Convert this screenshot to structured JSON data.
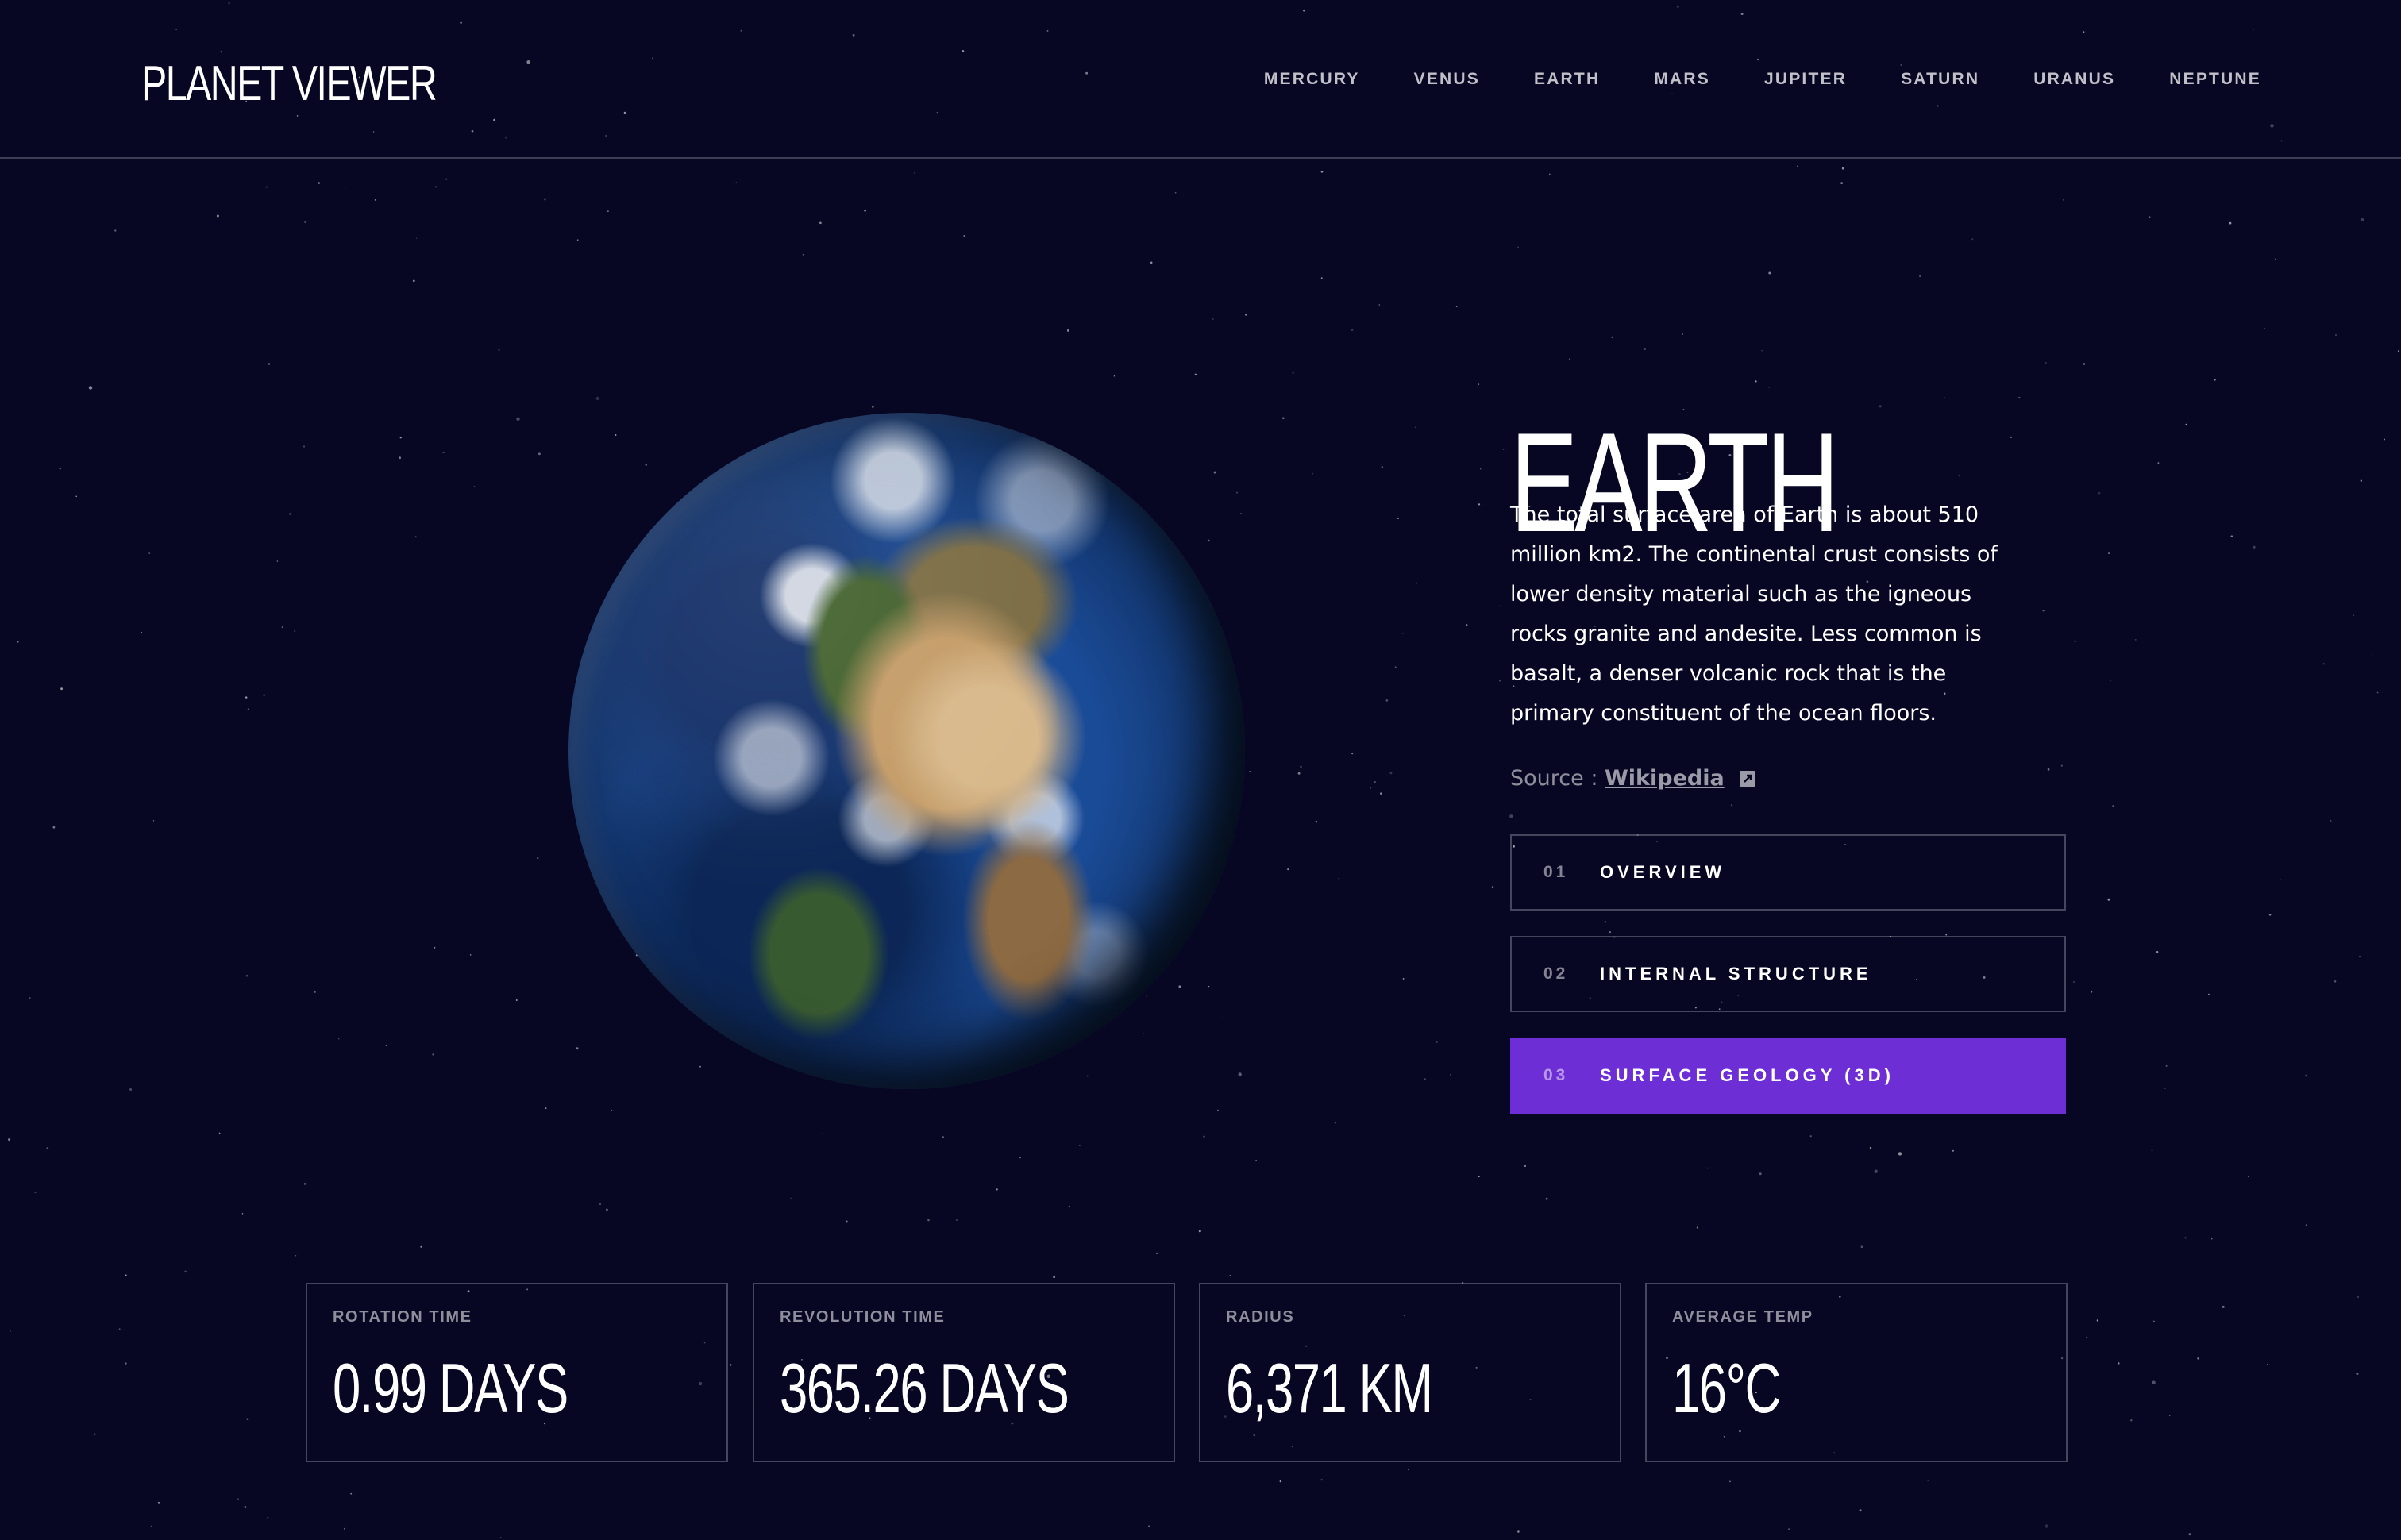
{
  "app": {
    "logo": "PLANET VIEWER"
  },
  "nav": {
    "items": [
      {
        "label": "MERCURY"
      },
      {
        "label": "VENUS"
      },
      {
        "label": "EARTH"
      },
      {
        "label": "MARS"
      },
      {
        "label": "JUPITER"
      },
      {
        "label": "SATURN"
      },
      {
        "label": "URANUS"
      },
      {
        "label": "NEPTUNE"
      }
    ]
  },
  "planet": {
    "name": "EARTH",
    "description": "The total surface area of Earth is about 510 million km2. The continental crust consists of lower density material such as the igneous rocks granite and andesite. Less common is basalt, a denser volcanic rock that is the primary constituent of the ocean floors.",
    "source_label": "Source :",
    "source_link_text": "Wikipedia",
    "source_icon": "external-link-icon"
  },
  "tabs": [
    {
      "number": "01",
      "label": "OVERVIEW",
      "active": false
    },
    {
      "number": "02",
      "label": "INTERNAL STRUCTURE",
      "active": false
    },
    {
      "number": "03",
      "label": "SURFACE GEOLOGY (3D)",
      "active": true
    }
  ],
  "stats": [
    {
      "label": "ROTATION TIME",
      "value": "0.99 DAYS"
    },
    {
      "label": "REVOLUTION TIME",
      "value": "365.26 DAYS"
    },
    {
      "label": "RADIUS",
      "value": "6,371 KM"
    },
    {
      "label": "AVERAGE TEMP",
      "value": "16°C"
    }
  ],
  "colors": {
    "background": "#070724",
    "accent": "#6D2ED5",
    "text": "#FFFFFF"
  }
}
